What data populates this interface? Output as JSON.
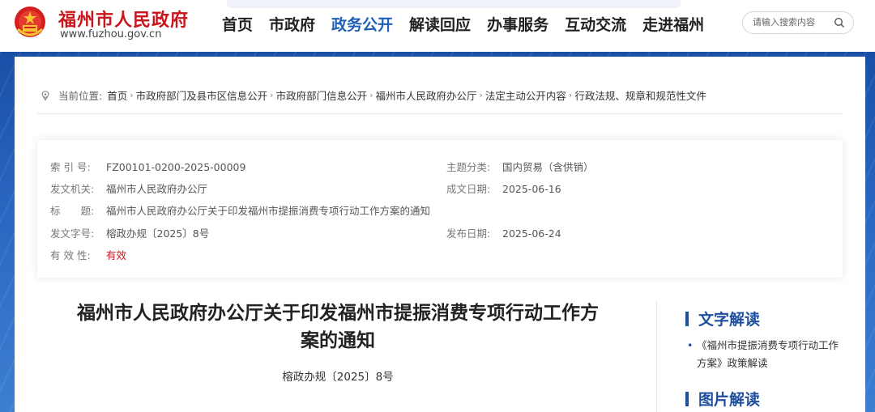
{
  "header": {
    "site_name": "福州市人民政府",
    "site_url": "www.fuzhou.gov.cn",
    "nav": [
      {
        "label": "首页",
        "active": false
      },
      {
        "label": "市政府",
        "active": false
      },
      {
        "label": "政务公开",
        "active": true
      },
      {
        "label": "解读回应",
        "active": false
      },
      {
        "label": "办事服务",
        "active": false
      },
      {
        "label": "互动交流",
        "active": false
      },
      {
        "label": "走进福州",
        "active": false
      }
    ],
    "search_placeholder": "请输入搜索内容"
  },
  "breadcrumb": {
    "label": "当前位置:",
    "items": [
      "首页",
      "市政府部门及县市区信息公开",
      "市政府部门信息公开",
      "福州市人民政府办公厅",
      "法定主动公开内容",
      "行政法规、规章和规范性文件"
    ]
  },
  "info": {
    "index_label": "索 引 号:",
    "index_value": "FZ00101-0200-2025-00009",
    "topic_label": "主题分类:",
    "topic_value": "国内贸易（含供销）",
    "issuer_label": "发文机关:",
    "issuer_value": "福州市人民政府办公厅",
    "date_label": "成文日期:",
    "date_value": "2025-06-16",
    "title_label": "标　　题:",
    "title_value": "福州市人民政府办公厅关于印发福州市提振消费专项行动工作方案的通知",
    "docno_label": "发文字号:",
    "docno_value": "榕政办规〔2025〕8号",
    "pub_label": "发布日期:",
    "pub_value": "2025-06-24",
    "valid_label": "有 效 性:",
    "valid_value": "有效"
  },
  "article": {
    "title_line1": "福州市人民政府办公厅关于印发福州市提振消费专项行动工作方",
    "title_line2": "案的通知",
    "doc_number": "榕政办规〔2025〕8号"
  },
  "sidebar": {
    "text_interp_title": "文字解读",
    "text_interp_item_line1": "《福州市提振消费专项行动工作",
    "text_interp_item_line2": "方案》政策解读",
    "image_interp_title": "图片解读"
  },
  "colors": {
    "brand_red": "#c8161d",
    "nav_active": "#1f5fb5",
    "band_blue": "#2a67c2",
    "sidebar_blue": "#1f4f9e"
  },
  "icons": {
    "emblem": "national-emblem-icon",
    "search": "search-icon",
    "location": "location-pin-icon"
  }
}
